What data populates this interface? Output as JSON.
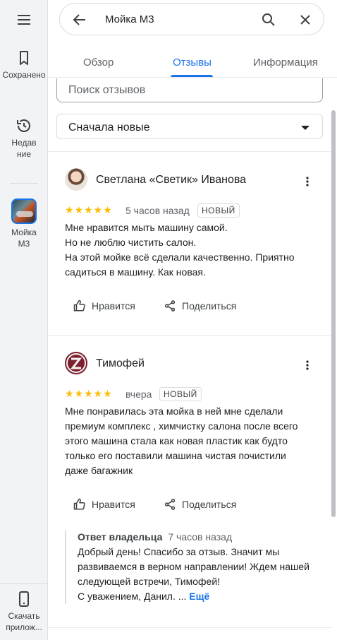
{
  "rail": {
    "saved_label": "Сохранено",
    "recent_label": "Недавние",
    "place_label": "Мойка М3",
    "download_label": "Скачать прилож..."
  },
  "search": {
    "query": "Мойка М3"
  },
  "tabs": [
    {
      "label": "Обзор"
    },
    {
      "label": "Отзывы"
    },
    {
      "label": "Информация"
    }
  ],
  "review_search": {
    "placeholder": "Поиск отзывов"
  },
  "sort": {
    "label": "Сначала новые"
  },
  "reviews": [
    {
      "author": "Светлана «Светик» Иванова",
      "stars": "★★★★★",
      "time": "5 часов назад",
      "badge": "НОВЫЙ",
      "lines": [
        "Мне нравится мыть машину самой.",
        "Но не люблю чистить салон.",
        "На этой мойке всё сделали качественно. Приятно",
        "садиться в машину. Как новая."
      ],
      "like_label": "Нравится",
      "share_label": "Поделиться"
    },
    {
      "author": "Тимофей",
      "stars": "★★★★★",
      "time": "вчера",
      "badge": "НОВЫЙ",
      "lines": [
        "Мне понравилась эта мойка в ней мне сделали",
        "премиум комплекс , химчистку салона после всего",
        "этого машина стала как новая пластик как будто",
        "только его поставили машина чистая почистили",
        "даже багажник"
      ],
      "like_label": "Нравится",
      "share_label": "Поделиться",
      "owner_reply": {
        "title": "Ответ владельца",
        "time": "7 часов назад",
        "lines": [
          "Добрый день! Спасибо за отзыв. Значит мы",
          "развиваемся в верном направлении! Ждем нашей",
          "следующей встречи, Тимофей!"
        ],
        "last_line": "С уважением, Данил. ...",
        "more_label": "Ещё"
      }
    }
  ],
  "colors": {
    "accent": "#1a73e8",
    "star": "#fbbc04"
  }
}
